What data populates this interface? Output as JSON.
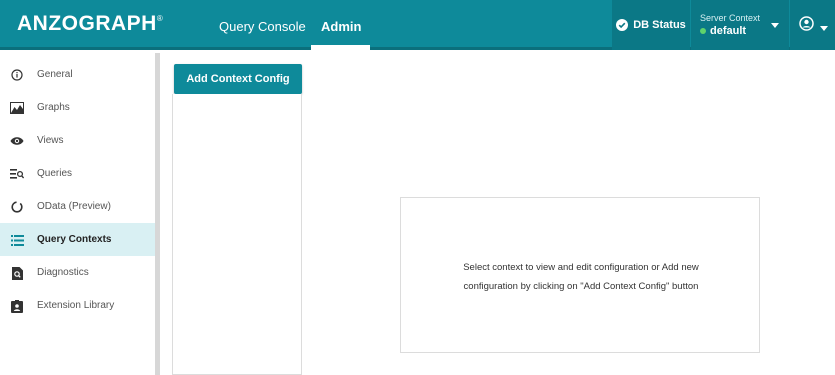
{
  "header": {
    "brand": "ANZOGRAPH",
    "brand_mark": "®",
    "nav": [
      {
        "label": "Query Console"
      },
      {
        "label": "Admin"
      }
    ],
    "db_status_label": "DB Status",
    "server_context_label": "Server Context",
    "server_context_value": "default"
  },
  "sidebar": {
    "items": [
      {
        "label": "General",
        "icon": "info-icon"
      },
      {
        "label": "Graphs",
        "icon": "graph-icon"
      },
      {
        "label": "Views",
        "icon": "eye-icon"
      },
      {
        "label": "Queries",
        "icon": "query-list-icon"
      },
      {
        "label": "OData (Preview)",
        "icon": "odata-icon"
      },
      {
        "label": "Query Contexts",
        "icon": "list-icon",
        "active": true
      },
      {
        "label": "Diagnostics",
        "icon": "diagnostics-icon"
      },
      {
        "label": "Extension Library",
        "icon": "extension-icon"
      }
    ]
  },
  "main": {
    "add_button_label": "Add Context Config",
    "message_line1": "Select context to view and edit configuration or Add new",
    "message_line2": "configuration by clicking on \"Add Context Config\" button"
  },
  "colors": {
    "primary": "#0e8a9a",
    "primary_dark": "#0b7886",
    "active_bg": "#d9f0f3",
    "status_green": "#5fd36c"
  }
}
